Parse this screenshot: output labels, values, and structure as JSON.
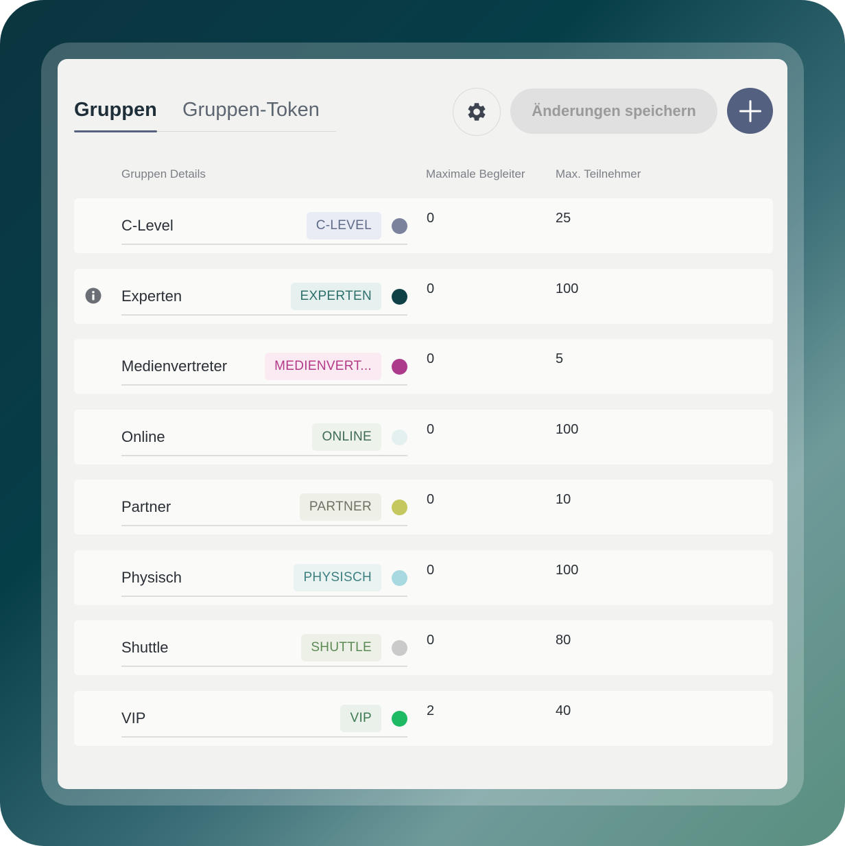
{
  "tabs": {
    "active": "Gruppen",
    "inactive": "Gruppen-Token"
  },
  "toolbar": {
    "save_label": "Änderungen speichern"
  },
  "columns": {
    "details": "Gruppen Details",
    "begleiter": "Maximale Begleiter",
    "teilnehmer": "Max. Teilnehmer"
  },
  "colors": {
    "accent": "#53607f",
    "panel": "#f2f2f1"
  },
  "groups": [
    {
      "name": "C-Level",
      "tag": "C-LEVEL",
      "tag_bg": "#e9ebf5",
      "tag_color": "#5f6b86",
      "dot": "#7a829c",
      "begleiter": "0",
      "teilnehmer": "25",
      "info": false
    },
    {
      "name": "Experten",
      "tag": "EXPERTEN",
      "tag_bg": "#e6f1ef",
      "tag_color": "#2d6e6a",
      "dot": "#0f4147",
      "begleiter": "0",
      "teilnehmer": "100",
      "info": true
    },
    {
      "name": "Medienvertreter",
      "tag": "MEDIENVERT...",
      "tag_bg": "#fbeaf2",
      "tag_color": "#b23a88",
      "dot": "#ad3b8b",
      "begleiter": "0",
      "teilnehmer": "5",
      "info": false
    },
    {
      "name": "Online",
      "tag": "ONLINE",
      "tag_bg": "#edf2ea",
      "tag_color": "#3f6a55",
      "dot": "#e4f0ef",
      "begleiter": "0",
      "teilnehmer": "100",
      "info": false
    },
    {
      "name": "Partner",
      "tag": "PARTNER",
      "tag_bg": "#eeefe6",
      "tag_color": "#6f7163",
      "dot": "#c4c85e",
      "begleiter": "0",
      "teilnehmer": "10",
      "info": false
    },
    {
      "name": "Physisch",
      "tag": "PHYSISCH",
      "tag_bg": "#e8f3f2",
      "tag_color": "#3f7f80",
      "dot": "#a8d8e0",
      "begleiter": "0",
      "teilnehmer": "100",
      "info": false
    },
    {
      "name": "Shuttle",
      "tag": "SHUTTLE",
      "tag_bg": "#ecf0e6",
      "tag_color": "#5c8a55",
      "dot": "#cacaca",
      "begleiter": "0",
      "teilnehmer": "80",
      "info": false
    },
    {
      "name": "VIP",
      "tag": "VIP",
      "tag_bg": "#e9f1ea",
      "tag_color": "#3d7a53",
      "dot": "#1dba63",
      "begleiter": "2",
      "teilnehmer": "40",
      "info": false
    }
  ]
}
